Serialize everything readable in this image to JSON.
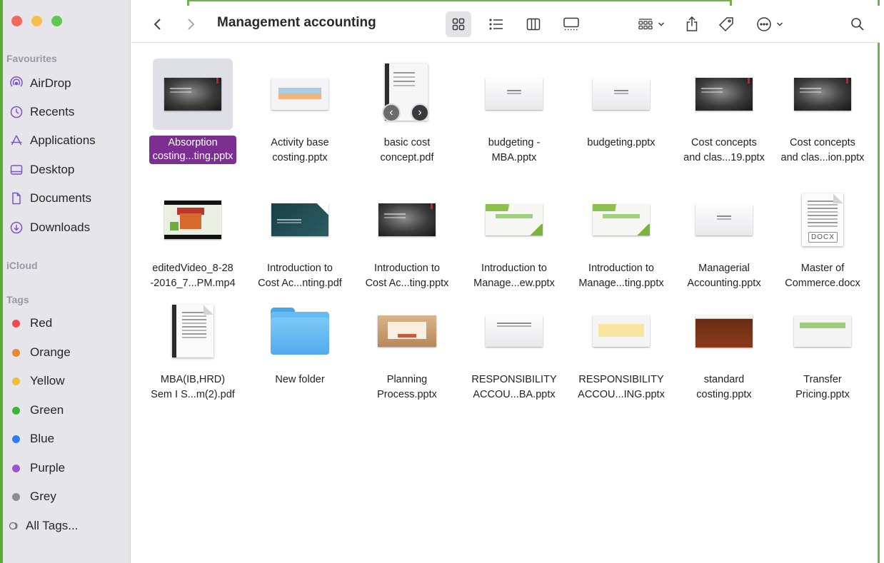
{
  "window": {
    "title": "Management accounting"
  },
  "sidebar": {
    "favourites_label": "Favourites",
    "favourites": [
      {
        "label": "AirDrop",
        "icon": "airdrop-icon"
      },
      {
        "label": "Recents",
        "icon": "clock-icon"
      },
      {
        "label": "Applications",
        "icon": "applications-icon"
      },
      {
        "label": "Desktop",
        "icon": "desktop-icon"
      },
      {
        "label": "Documents",
        "icon": "document-icon"
      },
      {
        "label": "Downloads",
        "icon": "download-icon"
      }
    ],
    "icloud_label": "iCloud",
    "tags_label": "Tags",
    "tags": [
      {
        "label": "Red",
        "color": "#ef4b4a"
      },
      {
        "label": "Orange",
        "color": "#e98a33"
      },
      {
        "label": "Yellow",
        "color": "#efc12f"
      },
      {
        "label": "Green",
        "color": "#3fb13e"
      },
      {
        "label": "Blue",
        "color": "#2f7ef1"
      },
      {
        "label": "Purple",
        "color": "#9a55d4"
      },
      {
        "label": "Grey",
        "color": "#8c8c91"
      }
    ],
    "all_tags_label": "All Tags..."
  },
  "colors": {
    "selection": "#7d2e93",
    "sidebar_bg": "#e6e5ea",
    "frame": "#5aaa3a"
  },
  "files": [
    {
      "line1": "Absorption",
      "line2": "costing...ting.pptx",
      "kind": "slide-dark",
      "selected": true
    },
    {
      "line1": "Activity base",
      "line2": "costing.pptx",
      "kind": "slide-peach"
    },
    {
      "line1": "basic cost",
      "line2": "concept.pdf",
      "kind": "pdf-preview"
    },
    {
      "line1": "budgeting -",
      "line2": "MBA.pptx",
      "kind": "slide-light"
    },
    {
      "line1": "budgeting.pptx",
      "line2": "",
      "kind": "slide-light"
    },
    {
      "line1": "Cost concepts",
      "line2": "and clas...19.pptx",
      "kind": "slide-dark"
    },
    {
      "line1": "Cost concepts",
      "line2": "and clas...ion.pptx",
      "kind": "slide-dark"
    },
    {
      "line1": "editedVideo_8-28",
      "line2": "-2016_7...PM.mp4",
      "kind": "video"
    },
    {
      "line1": "Introduction to",
      "line2": "Cost Ac...nting.pdf",
      "kind": "slide-teal"
    },
    {
      "line1": "Introduction to",
      "line2": "Cost Ac...ting.pptx",
      "kind": "slide-dark"
    },
    {
      "line1": "Introduction to",
      "line2": "Manage...ew.pptx",
      "kind": "slide-greenwave"
    },
    {
      "line1": "Introduction to",
      "line2": "Manage...ting.pptx",
      "kind": "slide-greenwave"
    },
    {
      "line1": "Managerial",
      "line2": "Accounting.pptx",
      "kind": "slide-light"
    },
    {
      "line1": "Master of",
      "line2": "Commerce.docx",
      "kind": "docx",
      "badge": "DOCX"
    },
    {
      "line1": "MBA(IB,HRD)",
      "line2": "Sem I S...m(2).pdf",
      "kind": "pdf-bound"
    },
    {
      "line1": "New folder",
      "line2": "",
      "kind": "folder"
    },
    {
      "line1": "Planning",
      "line2": "Process.pptx",
      "kind": "slide-wood"
    },
    {
      "line1": "RESPONSIBILITY",
      "line2": "ACCOU...BA.pptx",
      "kind": "slide-light"
    },
    {
      "line1": "RESPONSIBILITY",
      "line2": "ACCOU...ING.pptx",
      "kind": "slide-yellowband"
    },
    {
      "line1": "standard",
      "line2": "costing.pptx",
      "kind": "slide-brown"
    },
    {
      "line1": "Transfer",
      "line2": "Pricing.pptx",
      "kind": "slide-greenbar"
    }
  ]
}
